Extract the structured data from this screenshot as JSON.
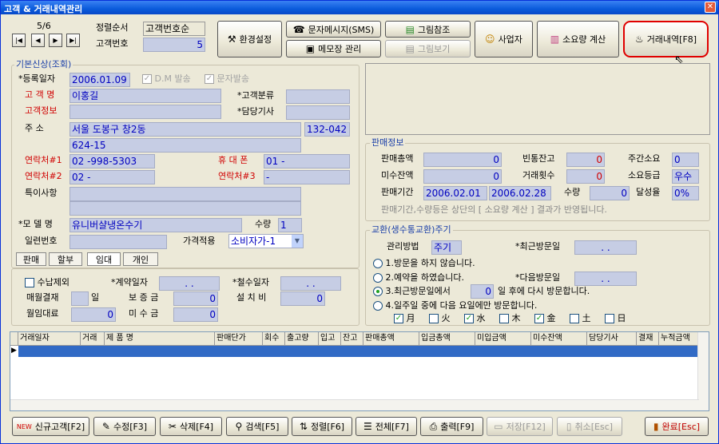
{
  "window": {
    "title": "고객 & 거래내역관리",
    "close": "✕"
  },
  "nav": {
    "record": "5/6",
    "first": "|◀",
    "prev": "◀",
    "next": "▶",
    "last": "▶|"
  },
  "sort": {
    "label": "정렬순서",
    "value": "고객번호순",
    "id_label": "고객번호",
    "id_value": "5"
  },
  "toolbar": {
    "env": "환경설정",
    "sms": "문자메시지(SMS)",
    "memo": "메모장 관리",
    "pic_ref": "그림참조",
    "pic_view": "그림보기",
    "owner": "사업자",
    "usage": "소요량 계산",
    "history": "거래내역[F8]"
  },
  "basic": {
    "group_title": "기본신상(조회)",
    "reg_date_label": "*등록일자",
    "reg_date": "2006.01.09",
    "dm_label": "D.M 발송",
    "sms_label": "문자발송",
    "name_label": "고 객 명",
    "name": "이홍길",
    "class_label": "*고객분류",
    "info_label": "고객정보",
    "tech_label": "*담당기사",
    "addr_label": "주    소",
    "addr1": "서울 도봉구 창2동",
    "zip": "132-042",
    "addr2": "624-15",
    "tel1_label": "연락처#1",
    "tel1": "02  -998-5303",
    "mobile_label": "휴 대 폰",
    "mobile": "01  -",
    "tel2_label": "연락처#2",
    "tel2": "02  -",
    "tel3_label": "연락처#3",
    "tel3": "-",
    "note_label": "특이사항",
    "model_label": "*모 델 명",
    "model": "유니버샬냉온수기",
    "qty_label": "수량",
    "qty": "1",
    "serial_label": "일련번호",
    "price_label": "가격적용",
    "price": "소비자가-1"
  },
  "tabs": [
    "판매",
    "할부",
    "임대",
    "개인"
  ],
  "rent": {
    "collect_label": "수납제외",
    "contract_label": "*계약일자",
    "contract": ".    .",
    "remove_label": "*철수일자",
    "remove": ".    .",
    "monthly_label": "매월결재",
    "monthly_unit": "일",
    "deposit_label": "보 증 금",
    "deposit": "0",
    "install_label": "설 치 비",
    "install": "0",
    "fee_label": "월임대료",
    "fee": "0",
    "unpaid_label": "미 수 금",
    "unpaid": "0"
  },
  "sales": {
    "group_title": "판매정보",
    "total_label": "판매총액",
    "total": "0",
    "empty_label": "빈통잔고",
    "empty": "0",
    "weekly_label": "주간소요",
    "weekly": "0",
    "unpaid_label": "미수잔액",
    "unpaid": "0",
    "count_label": "거래횟수",
    "count": "0",
    "grade_label": "소요등급",
    "grade": "우수",
    "period_label": "판매기간",
    "from": "2006.02.01",
    "to": "2006.02.28",
    "qty_label": "수량",
    "qty": "0",
    "rate_label": "달성율",
    "rate": "0%",
    "note": "판매기간,수량등은 상단의 [ 소요량 계산 ] 결과가 반영됩니다."
  },
  "exchange": {
    "group_title": "교환(생수통교환)주기",
    "method_label": "관리방법",
    "method": "주기",
    "last_label": "*최근방문일",
    "last": ".    .",
    "opt1": "1.방문을 하지 않습니다.",
    "opt2": "2.예약을 하였습니다.",
    "next_label": "*다음방문일",
    "next": ".    .",
    "opt3a": "3.최근방문일에서",
    "opt3_val": "0",
    "opt3b": "일 후에 다시 방문합니다.",
    "opt4": "4.일주일 중에 다음 요일에만 방문합니다.",
    "days": [
      "月",
      "火",
      "水",
      "木",
      "金",
      "土",
      "日"
    ]
  },
  "grid": {
    "columns": [
      "거래일자",
      "거래",
      "제  품  명",
      "판매단가",
      "회수",
      "출고량",
      "입고",
      "잔고",
      "판매총액",
      "입금총액",
      "미입금액",
      "미수잔액",
      "담당기사",
      "결재",
      "누적금액"
    ]
  },
  "bottom": {
    "new": "신규고객[F2]",
    "edit": "수정[F3]",
    "del": "삭제[F4]",
    "search": "검색[F5]",
    "sort": "정렬[F6]",
    "all": "전체[F7]",
    "print": "출력[F9]",
    "save": "저장[F12]",
    "cancel": "취소[Esc]",
    "done": "완료[Esc]",
    "new_badge": "NEW"
  },
  "colors": {
    "highlight": "#e00000",
    "accent": "#316ac5"
  }
}
